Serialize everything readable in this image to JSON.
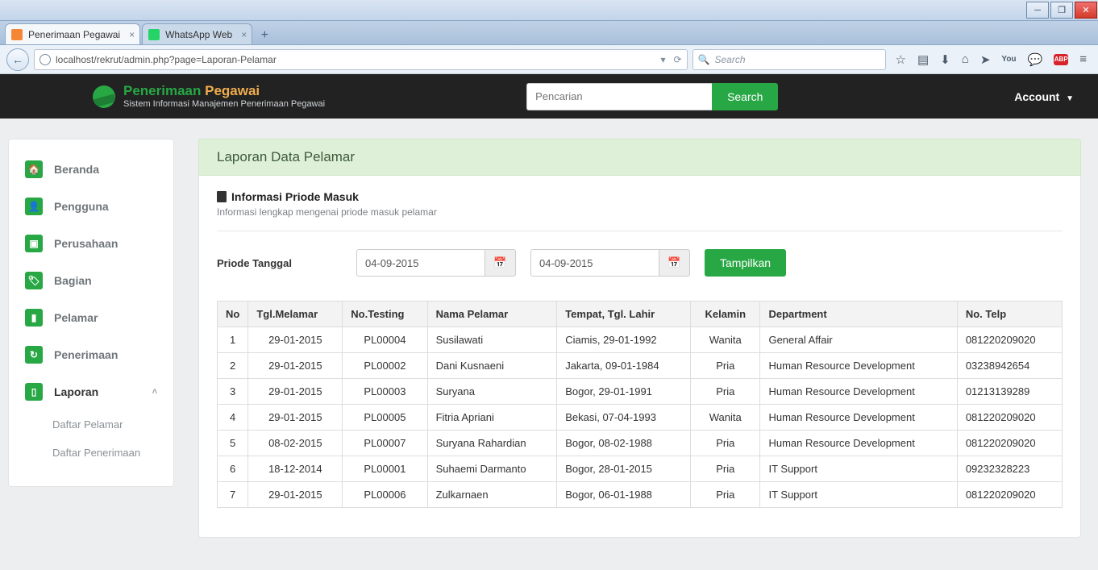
{
  "browser": {
    "tabs": [
      {
        "label": "Penerimaan Pegawai",
        "active": true,
        "favicon": "fav-orange"
      },
      {
        "label": "WhatsApp Web",
        "active": false,
        "favicon": "fav-green"
      }
    ],
    "url": "localhost/rekrut/admin.php?page=Laporan-Pelamar",
    "search_placeholder": "Search"
  },
  "header": {
    "brand_a": "Penerimaan",
    "brand_b": "Pegawai",
    "brand_sub": "Sistem Informasi Manajemen Penerimaan Pegawai",
    "search_placeholder": "Pencarian",
    "search_button": "Search",
    "account_label": "Account"
  },
  "sidebar": {
    "items": [
      {
        "label": "Beranda",
        "icon": "home"
      },
      {
        "label": "Pengguna",
        "icon": "user"
      },
      {
        "label": "Perusahaan",
        "icon": "image"
      },
      {
        "label": "Bagian",
        "icon": "tag"
      },
      {
        "label": "Pelamar",
        "icon": "bar"
      },
      {
        "label": "Penerimaan",
        "icon": "share"
      },
      {
        "label": "Laporan",
        "icon": "doc",
        "expanded": true
      }
    ],
    "sub_items": [
      {
        "label": "Daftar Pelamar"
      },
      {
        "label": "Daftar Penerimaan"
      }
    ]
  },
  "page": {
    "title": "Laporan Data Pelamar",
    "section_title": "Informasi Priode Masuk",
    "section_sub": "Informasi lengkap mengenai priode masuk pelamar",
    "filter_label": "Priode Tanggal",
    "date_from": "04-09-2015",
    "date_to": "04-09-2015",
    "show_button": "Tampilkan"
  },
  "table": {
    "headers": [
      "No",
      "Tgl.Melamar",
      "No.Testing",
      "Nama Pelamar",
      "Tempat, Tgl. Lahir",
      "Kelamin",
      "Department",
      "No. Telp"
    ],
    "rows": [
      {
        "no": "1",
        "tgl": "29-01-2015",
        "test": "PL00004",
        "nama": "Susilawati",
        "ttl": "Ciamis, 29-01-1992",
        "kel": "Wanita",
        "dept": "General Affair",
        "telp": "081220209020"
      },
      {
        "no": "2",
        "tgl": "29-01-2015",
        "test": "PL00002",
        "nama": "Dani Kusnaeni",
        "ttl": "Jakarta, 09-01-1984",
        "kel": "Pria",
        "dept": "Human Resource Development",
        "telp": "03238942654"
      },
      {
        "no": "3",
        "tgl": "29-01-2015",
        "test": "PL00003",
        "nama": "Suryana",
        "ttl": "Bogor, 29-01-1991",
        "kel": "Pria",
        "dept": "Human Resource Development",
        "telp": "01213139289"
      },
      {
        "no": "4",
        "tgl": "29-01-2015",
        "test": "PL00005",
        "nama": "Fitria Apriani",
        "ttl": "Bekasi, 07-04-1993",
        "kel": "Wanita",
        "dept": "Human Resource Development",
        "telp": "081220209020"
      },
      {
        "no": "5",
        "tgl": "08-02-2015",
        "test": "PL00007",
        "nama": "Suryana Rahardian",
        "ttl": "Bogor, 08-02-1988",
        "kel": "Pria",
        "dept": "Human Resource Development",
        "telp": "081220209020"
      },
      {
        "no": "6",
        "tgl": "18-12-2014",
        "test": "PL00001",
        "nama": "Suhaemi Darmanto",
        "ttl": "Bogor, 28-01-2015",
        "kel": "Pria",
        "dept": "IT Support",
        "telp": "09232328223"
      },
      {
        "no": "7",
        "tgl": "29-01-2015",
        "test": "PL00006",
        "nama": "Zulkarnaen",
        "ttl": "Bogor, 06-01-1988",
        "kel": "Pria",
        "dept": "IT Support",
        "telp": "081220209020"
      }
    ]
  }
}
